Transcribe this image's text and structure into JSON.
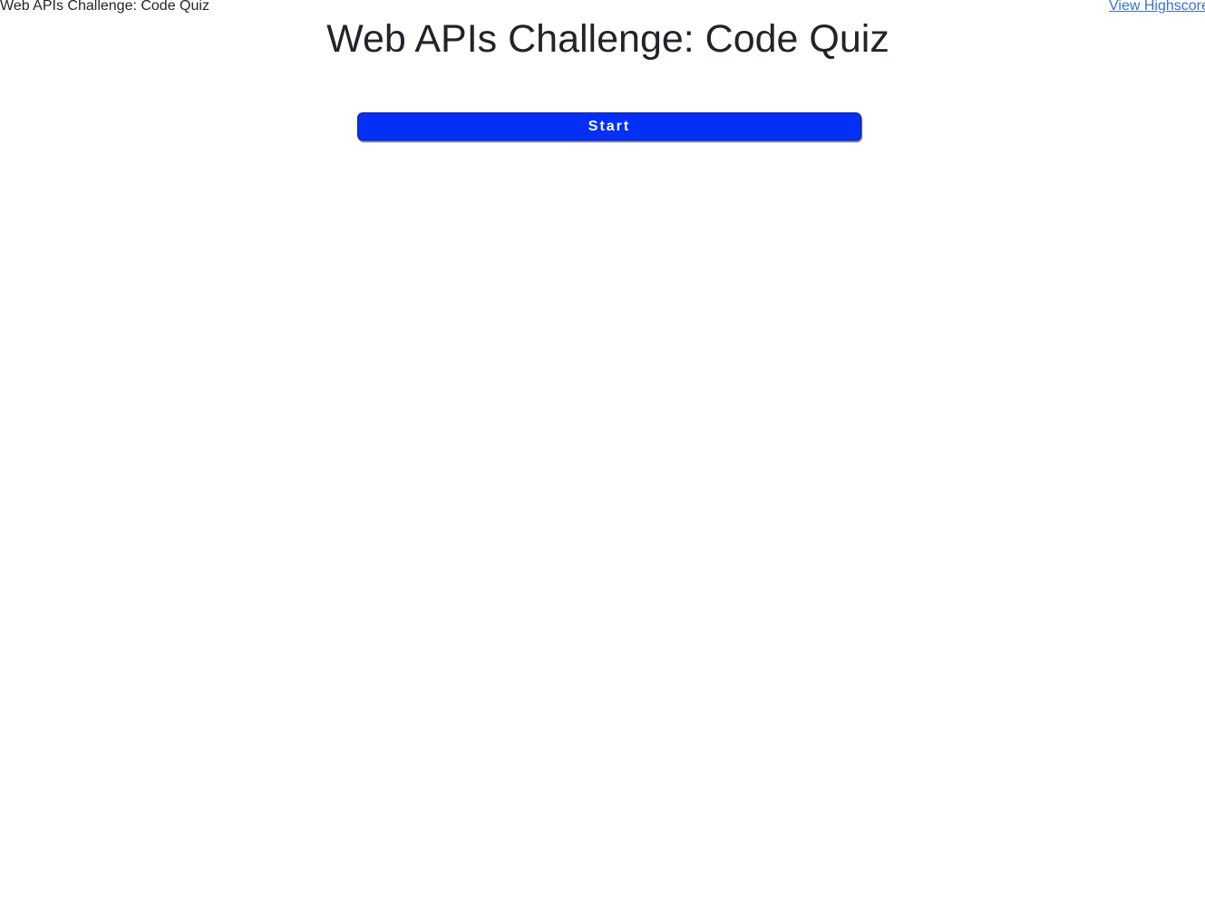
{
  "header": {
    "site_title": "Web APIs Challenge: Code Quiz",
    "highscore_link": "View Highscore"
  },
  "main": {
    "title": "Web APIs Challenge: Code Quiz",
    "start_label": "Start"
  },
  "colors": {
    "link": "#3b6fd6",
    "start_button_bg": "#0430f6",
    "start_button_text": "#ffffff",
    "text": "#212529"
  }
}
